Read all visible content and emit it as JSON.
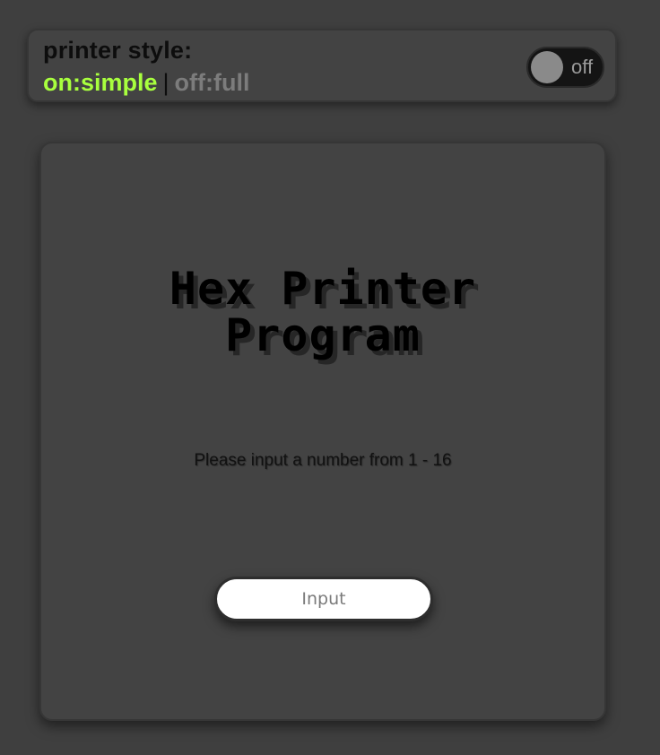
{
  "settings": {
    "title": "printer style:",
    "option_on": "on:simple",
    "separator": "|",
    "option_off": "off:full",
    "toggle_state_label": "off"
  },
  "main": {
    "title_line1": "Hex Printer",
    "title_line2": "Program",
    "prompt": "Please input a number from 1 - 16",
    "input": {
      "value": "",
      "placeholder": "Input"
    }
  },
  "colors": {
    "background": "#3f3f3f",
    "panel": "#434343",
    "accent_on": "#a8ff3e",
    "muted_off": "#7c7c7c",
    "toggle_track": "#141414",
    "toggle_knob": "#8a8a8a"
  }
}
